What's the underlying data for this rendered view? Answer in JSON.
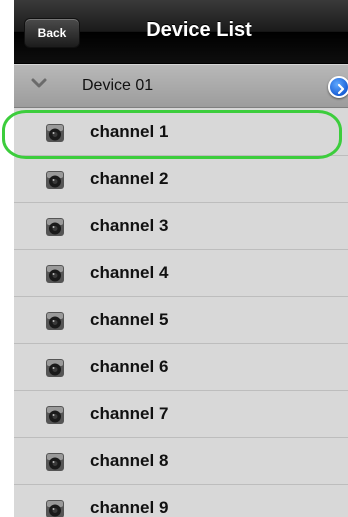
{
  "navbar": {
    "back_label": "Back",
    "title": "Device List"
  },
  "device": {
    "label": "Device 01",
    "expand_icon": "chevron-down-icon",
    "detail_icon": "detail-disclosure-icon"
  },
  "channels": [
    {
      "label": "channel 1",
      "icon": "camera-icon"
    },
    {
      "label": "channel 2",
      "icon": "camera-icon"
    },
    {
      "label": "channel 3",
      "icon": "camera-icon"
    },
    {
      "label": "channel 4",
      "icon": "camera-icon"
    },
    {
      "label": "channel 5",
      "icon": "camera-icon"
    },
    {
      "label": "channel 6",
      "icon": "camera-icon"
    },
    {
      "label": "channel 7",
      "icon": "camera-icon"
    },
    {
      "label": "channel 8",
      "icon": "camera-icon"
    },
    {
      "label": "channel 9",
      "icon": "camera-icon"
    }
  ],
  "colors": {
    "highlight": "#3ccd3c",
    "detail_blue": "#1a5fd6"
  }
}
